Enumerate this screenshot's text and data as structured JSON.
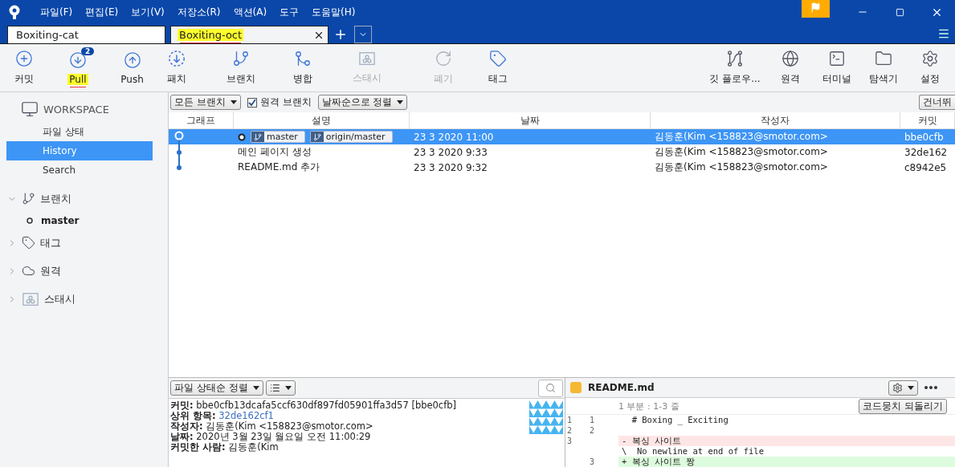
{
  "menu": [
    "파일(F)",
    "편집(E)",
    "보기(V)",
    "저장소(R)",
    "액션(A)",
    "도구",
    "도움말(H)"
  ],
  "tabs": [
    {
      "label": "Boxiting-cat",
      "selected": false,
      "highlighted": false
    },
    {
      "label": "Boxiting-oct",
      "selected": true,
      "highlighted": true
    }
  ],
  "toolbar_left": [
    {
      "kind": "commit",
      "label": "커밋",
      "disabled": false,
      "highlighted": false
    },
    {
      "kind": "pull",
      "label": "Pull",
      "badge": "2",
      "disabled": false,
      "highlighted": true
    },
    {
      "kind": "push",
      "label": "Push",
      "disabled": false,
      "highlighted": false
    },
    {
      "kind": "fetch",
      "label": "패치",
      "disabled": false,
      "highlighted": false
    },
    {
      "kind": "branch",
      "label": "브랜치",
      "disabled": false,
      "highlighted": false
    },
    {
      "kind": "merge",
      "label": "병합",
      "disabled": false,
      "highlighted": false
    },
    {
      "kind": "stash",
      "label": "스태시",
      "disabled": true,
      "highlighted": false
    },
    {
      "kind": "discard",
      "label": "폐기",
      "disabled": true,
      "highlighted": false
    },
    {
      "kind": "tag",
      "label": "태그",
      "disabled": false,
      "highlighted": false
    }
  ],
  "toolbar_right": [
    {
      "kind": "gitflow",
      "label": "깃 플로우..."
    },
    {
      "kind": "remote",
      "label": "원격"
    },
    {
      "kind": "terminal",
      "label": "터미널"
    },
    {
      "kind": "explorer",
      "label": "탐색기"
    },
    {
      "kind": "settings",
      "label": "설정"
    }
  ],
  "sidebar": {
    "workspace": {
      "title": "WORKSPACE",
      "items": [
        {
          "label": "파일 상태",
          "selected": false
        },
        {
          "label": "History",
          "selected": true
        },
        {
          "label": "Search",
          "selected": false
        }
      ]
    },
    "sections": [
      {
        "kind": "branch",
        "label": "브랜치",
        "expanded": true,
        "children": [
          {
            "label": "master",
            "current": true
          }
        ]
      },
      {
        "kind": "tag",
        "label": "태그",
        "expanded": false
      },
      {
        "kind": "remote",
        "label": "원격",
        "expanded": false
      },
      {
        "kind": "stash",
        "label": "스태시",
        "expanded": false
      }
    ]
  },
  "filters": {
    "branches": "모든 브랜치",
    "remote_branches": {
      "label": "원격 브랜치",
      "checked": true
    },
    "sort": "날짜순으로 정렬",
    "jump": "건너뛰"
  },
  "table": {
    "columns": [
      "그래프",
      "설명",
      "날짜",
      "작성자",
      "커밋"
    ],
    "rows": [
      {
        "selected": true,
        "head": true,
        "refs": [
          "master",
          "origin/master"
        ],
        "description": "",
        "date": "23 3 2020 11:00",
        "author": "김동훈(Kim <158823@smotor.com>",
        "commit": "bbe0cfb"
      },
      {
        "selected": false,
        "head": false,
        "refs": [],
        "description": "메인 페이지 생성",
        "date": "23 3 2020 9:33",
        "author": "김동훈(Kim <158823@smotor.com>",
        "commit": "32de162"
      },
      {
        "selected": false,
        "head": false,
        "refs": [],
        "description": "README.md 추가",
        "date": "23 3 2020 9:32",
        "author": "김동훈(Kim <158823@smotor.com>",
        "commit": "c8942e5"
      }
    ]
  },
  "details": {
    "sort": "파일 상태순 정렬",
    "lines": [
      {
        "label": "커밋:",
        "value": "bbe0cfb13dcafa5ccf630df897fd05901ffa3d57 [bbe0cfb]",
        "link": false
      },
      {
        "label": "상위 항목:",
        "value": "32de162cf1",
        "link": true
      },
      {
        "label": "작성자:",
        "value": "김동훈(Kim <158823@smotor.com>",
        "link": false
      },
      {
        "label": "날짜:",
        "value": "2020년 3월 23일 월요일 오전 11:00:29",
        "link": false
      },
      {
        "label": "커밋한 사람:",
        "value": "김동훈(Kim",
        "link": false
      }
    ]
  },
  "diff": {
    "file": "README.md",
    "hunk": "1 부분 : 1-3 줄",
    "revert": "코드뭉치 되돌리기",
    "lines": [
      {
        "kind": "context",
        "old": "1",
        "new": "1",
        "text": "  # Boxing _ Exciting"
      },
      {
        "kind": "context",
        "old": "2",
        "new": "2"
      },
      {
        "kind": "removed",
        "old": "3",
        "text": "- 복싱 사이트"
      },
      {
        "kind": "note",
        "text": "\\  No newline at end of file"
      },
      {
        "kind": "added",
        "new": "3",
        "text": "+ 복싱 사이트 짱"
      }
    ]
  }
}
